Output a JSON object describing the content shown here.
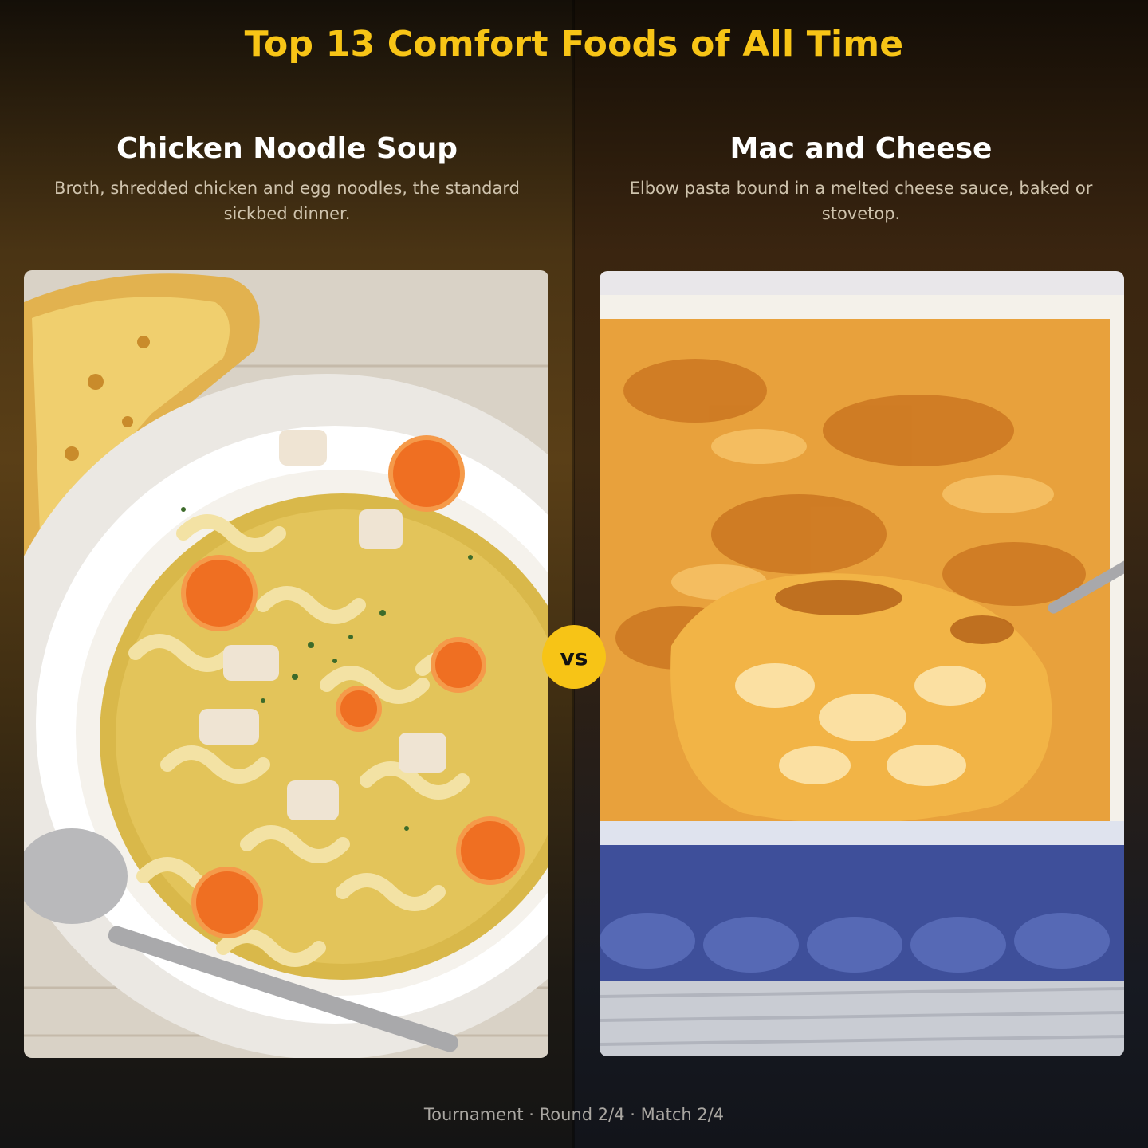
{
  "header": {
    "title": "Top 13 Comfort Foods of All Time"
  },
  "left": {
    "name": "Chicken Noodle Soup",
    "description": "Broth, shredded chicken and egg noodles, the standard sickbed dinner."
  },
  "right": {
    "name": "Mac and Cheese",
    "description": "Elbow pasta bound in a melted cheese sauce, baked or stovetop."
  },
  "vs_label": "vs",
  "footer": {
    "status": "Tournament · Round 2/4 · Match 2/4"
  }
}
